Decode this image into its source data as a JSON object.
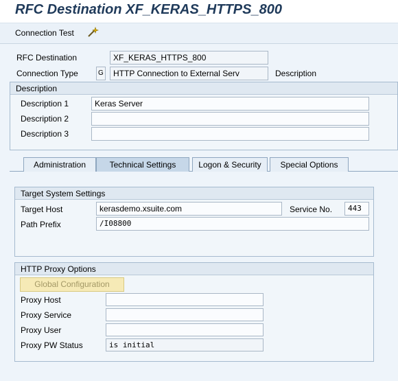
{
  "title": "RFC Destination XF_KERAS_HTTPS_800",
  "toolbar": {
    "connection_test": "Connection Test",
    "wand_icon": "magic-wand-icon"
  },
  "header": {
    "rfc_destination_label": "RFC Destination",
    "rfc_destination_value": "XF_KERAS_HTTPS_800",
    "connection_type_label": "Connection Type",
    "connection_type_code": "G",
    "connection_type_value": "HTTP Connection to External Serv",
    "description_label": "Description"
  },
  "description_group": {
    "header": "Description",
    "desc1_label": "Description 1",
    "desc1_value": "Keras Server",
    "desc2_label": "Description 2",
    "desc2_value": "",
    "desc3_label": "Description 3",
    "desc3_value": ""
  },
  "tabs": [
    {
      "label": "Administration"
    },
    {
      "label": "Technical Settings"
    },
    {
      "label": "Logon & Security"
    },
    {
      "label": "Special Options"
    }
  ],
  "target_group": {
    "header": "Target System Settings",
    "target_host_label": "Target Host",
    "target_host_value": "kerasdemo.xsuite.com",
    "service_no_label": "Service No.",
    "service_no_value": "443",
    "path_prefix_label": "Path Prefix",
    "path_prefix_value": "/I08800"
  },
  "proxy_group": {
    "header": "HTTP Proxy Options",
    "global_config_button": "Global Configuration",
    "proxy_host_label": "Proxy Host",
    "proxy_host_value": "",
    "proxy_service_label": "Proxy Service",
    "proxy_service_value": "",
    "proxy_user_label": "Proxy User",
    "proxy_user_value": "",
    "proxy_pw_status_label": "Proxy PW Status",
    "proxy_pw_status_value": "is initial"
  }
}
